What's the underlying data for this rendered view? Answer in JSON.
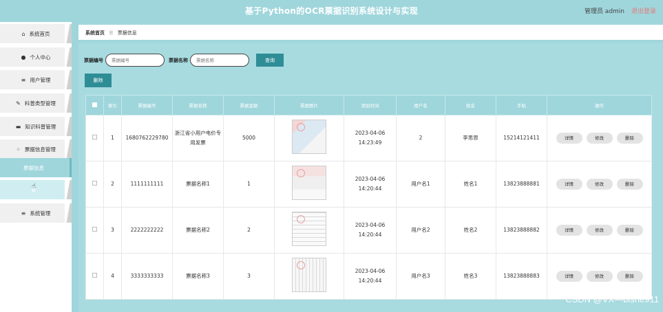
{
  "header": {
    "title": "基于Python的OCR票据识别系统设计与实现",
    "user": "管理员 admin",
    "logout": "退出登录"
  },
  "sidebar": {
    "items": [
      {
        "label": "系统首页",
        "icon": "home-icon",
        "glyph": "⌂"
      },
      {
        "label": "个人中心",
        "icon": "person-icon",
        "glyph": "●"
      },
      {
        "label": "用户管理",
        "icon": "list-icon",
        "glyph": "≡"
      },
      {
        "label": "科普类型管理",
        "icon": "edit-icon",
        "glyph": "✎"
      },
      {
        "label": "知识科普管理",
        "icon": "monitor-icon",
        "glyph": "▬"
      },
      {
        "label": "票据信息管理",
        "icon": "grid-icon",
        "glyph": "⁘"
      },
      {
        "label": "票据信息"
      },
      {
        "label": "",
        "icon": "gear-icon",
        "glyph": "⚙"
      },
      {
        "label": "系统管理",
        "icon": "list-icon",
        "glyph": "≡"
      }
    ]
  },
  "breadcrumb": {
    "home": "系统首页",
    "sep": "☰",
    "current": "票据信息"
  },
  "search": {
    "no_label": "票据编号",
    "no_placeholder": "票据编号",
    "name_label": "票据名称",
    "name_placeholder": "票据名称",
    "query_btn": "查询"
  },
  "delete_btn": "删除",
  "table": {
    "headers": [
      "索引",
      "票据编号",
      "票据名称",
      "票据金额",
      "票据图片",
      "添加时间",
      "用户名",
      "姓名",
      "手机",
      "操作"
    ],
    "rows": [
      {
        "idx": "1",
        "no": "1680762229780",
        "name": "浙江省小用户电价专用发票",
        "amount": "5000",
        "time": "2023-04-06 14:23:49",
        "user": "2",
        "fullname": "李思思",
        "phone": "15214121411"
      },
      {
        "idx": "2",
        "no": "1111111111",
        "name": "票据名称1",
        "amount": "1",
        "time": "2023-04-06 14:20:44",
        "user": "用户名1",
        "fullname": "姓名1",
        "phone": "13823888881"
      },
      {
        "idx": "3",
        "no": "2222222222",
        "name": "票据名称2",
        "amount": "2",
        "time": "2023-04-06 14:20:44",
        "user": "用户名2",
        "fullname": "姓名2",
        "phone": "13823888882"
      },
      {
        "idx": "4",
        "no": "3333333333",
        "name": "票据名称3",
        "amount": "3",
        "time": "2023-04-06 14:20:44",
        "user": "用户名3",
        "fullname": "姓名3",
        "phone": "13823888883"
      }
    ],
    "actions": {
      "detail": "详情",
      "edit": "修改",
      "delete": "删除"
    }
  },
  "watermark": "CSDN @VX—bishe911"
}
